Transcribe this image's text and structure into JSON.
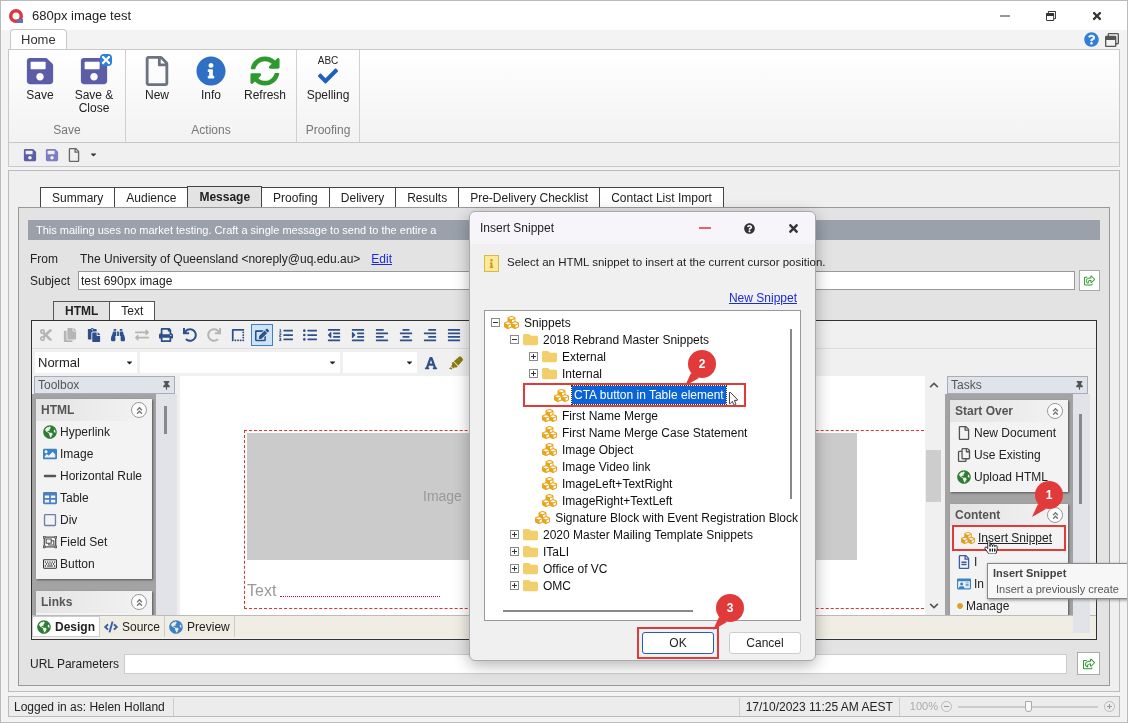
{
  "window": {
    "title": "680px image test"
  },
  "ribbon": {
    "tabs": [
      {
        "label": "Home",
        "selected": true
      }
    ],
    "groups": [
      {
        "label": "Save",
        "buttons": [
          {
            "label": "Save",
            "kind": "save"
          },
          {
            "label": "Save & Close",
            "kind": "save-close"
          }
        ]
      },
      {
        "label": "Actions",
        "buttons": [
          {
            "label": "New",
            "kind": "new"
          },
          {
            "label": "Info",
            "kind": "info"
          },
          {
            "label": "Refresh",
            "kind": "refresh"
          }
        ]
      },
      {
        "label": "Proofing",
        "buttons": [
          {
            "label": "Spelling",
            "kind": "spelling",
            "icon_text": "ABC"
          }
        ]
      }
    ]
  },
  "mailing_tabs": [
    {
      "label": "Summary",
      "selected": false
    },
    {
      "label": "Audience",
      "selected": false
    },
    {
      "label": "Message",
      "selected": true
    },
    {
      "label": "Proofing",
      "selected": false
    },
    {
      "label": "Delivery",
      "selected": false
    },
    {
      "label": "Results",
      "selected": false
    },
    {
      "label": "Pre-Delivery Checklist",
      "selected": false
    },
    {
      "label": "Contact List Import",
      "selected": false
    }
  ],
  "banner": "This mailing uses no market testing. Craft a single message to send to the entire a",
  "from": {
    "label": "From",
    "value": "The University of Queensland <noreply@uq.edu.au>",
    "link": "Edit"
  },
  "subject": {
    "label": "Subject",
    "value": "test 690px image"
  },
  "editor": {
    "tabs": [
      {
        "label": "HTML",
        "selected": true
      },
      {
        "label": "Text",
        "selected": false
      }
    ],
    "toolbar": [
      {
        "kind": "cut",
        "disabled": true,
        "selected": false
      },
      {
        "kind": "copy",
        "disabled": true,
        "selected": false
      },
      {
        "kind": "paste",
        "disabled": false,
        "selected": false
      },
      {
        "kind": "find",
        "disabled": false,
        "selected": false
      },
      {
        "kind": "replace",
        "disabled": true,
        "selected": false
      },
      {
        "kind": "print",
        "disabled": false,
        "selected": false
      },
      {
        "kind": "undo",
        "disabled": false,
        "selected": false
      },
      {
        "kind": "redo",
        "disabled": true,
        "selected": false
      },
      {
        "kind": "borders",
        "disabled": false,
        "selected": false
      },
      {
        "kind": "design",
        "disabled": false,
        "selected": true
      },
      {
        "kind": "numbered",
        "disabled": false,
        "selected": false
      },
      {
        "kind": "bullets",
        "disabled": false,
        "selected": false
      },
      {
        "kind": "outdent",
        "disabled": false,
        "selected": false
      },
      {
        "kind": "indent",
        "disabled": false,
        "selected": false
      },
      {
        "kind": "left",
        "disabled": false,
        "selected": false
      },
      {
        "kind": "center",
        "disabled": false,
        "selected": false
      },
      {
        "kind": "right",
        "disabled": false,
        "selected": false
      },
      {
        "kind": "justify",
        "disabled": false,
        "selected": false
      }
    ],
    "paragraph_style": "Normal",
    "toolbox": {
      "title": "Toolbox",
      "groups": [
        {
          "title": "HTML",
          "items": [
            {
              "label": "Hyperlink",
              "kind": "hyperlink"
            },
            {
              "label": "Image",
              "kind": "image"
            },
            {
              "label": "Horizontal Rule",
              "kind": "rule"
            },
            {
              "label": "Table",
              "kind": "table"
            },
            {
              "label": "Div",
              "kind": "div"
            },
            {
              "label": "Field Set",
              "kind": "fieldset"
            },
            {
              "label": "Button",
              "kind": "button"
            }
          ]
        },
        {
          "title": "Links"
        }
      ]
    },
    "canvas": {
      "image_placeholder": "Image",
      "text_placeholder": "Text"
    },
    "tasks": {
      "title": "Tasks",
      "groups": [
        {
          "title": "Start Over",
          "items": [
            {
              "label": "New Document",
              "kind": "new"
            },
            {
              "label": "Use Existing",
              "kind": "existing"
            },
            {
              "label": "Upload HTML",
              "kind": "upload"
            }
          ]
        },
        {
          "title": "Content",
          "items": [
            {
              "label": "Insert Snippet",
              "kind": "snippet",
              "callout": "1"
            },
            {
              "label": "I",
              "kind": "symbol"
            },
            {
              "label": "In",
              "kind": "image"
            },
            {
              "label": "Manage",
              "kind": "manage"
            }
          ]
        }
      ]
    },
    "view_tabs": [
      {
        "label": "Design",
        "kind": "design",
        "selected": true
      },
      {
        "label": "Source",
        "kind": "source",
        "selected": false
      },
      {
        "label": "Preview",
        "kind": "preview",
        "selected": false
      }
    ]
  },
  "url_parameters": {
    "label": "URL Parameters"
  },
  "dialog": {
    "title": "Insert Snippet",
    "message": "Select an HTML snippet to insert at the current cursor position.",
    "link": "New Snippet",
    "tree": [
      {
        "label": "Snippets",
        "kind": "root",
        "expanded": true,
        "selected": false,
        "children": [
          {
            "label": "2018 Rebrand Master Snippets",
            "kind": "folder",
            "expanded": true,
            "selected": false,
            "children": [
              {
                "label": "External",
                "kind": "folder",
                "expanded": false,
                "selected": false
              },
              {
                "label": "Internal",
                "kind": "folder",
                "expanded": false,
                "selected": false
              },
              {
                "label": "CTA button in Table element",
                "kind": "snippet",
                "selected": true,
                "callout": "2"
              },
              {
                "label": "First Name Merge",
                "kind": "snippet",
                "selected": false
              },
              {
                "label": "First Name Merge Case Statement",
                "kind": "snippet",
                "selected": false
              },
              {
                "label": "Image Object",
                "kind": "snippet",
                "selected": false
              },
              {
                "label": "Image Video link",
                "kind": "snippet",
                "selected": false
              },
              {
                "label": "ImageLeft+TextRight",
                "kind": "snippet",
                "selected": false
              },
              {
                "label": "ImageRight+TextLeft",
                "kind": "snippet",
                "selected": false
              },
              {
                "label": "Signature Block with Event Registration Block",
                "kind": "snippet",
                "selected": false
              }
            ]
          },
          {
            "label": "2020 Master Mailing Template Snippets",
            "kind": "folder",
            "expanded": false,
            "selected": false
          },
          {
            "label": "ITaLI",
            "kind": "folder",
            "expanded": false,
            "selected": false
          },
          {
            "label": "Office of VC",
            "kind": "folder",
            "expanded": false,
            "selected": false
          },
          {
            "label": "OMC",
            "kind": "folder",
            "expanded": false,
            "selected": false
          }
        ]
      }
    ],
    "buttons": [
      {
        "label": "OK",
        "default": true,
        "callout": "3"
      },
      {
        "label": "Cancel",
        "default": false
      }
    ]
  },
  "tooltip": {
    "title": "Insert Snippet",
    "text": "Insert a previously create"
  },
  "status_bar": {
    "user": "Logged in as: Helen Holland",
    "datetime": "17/10/2023 11:25 AM AEST",
    "zoom": {
      "reading": "100%",
      "level": 0.5
    }
  }
}
